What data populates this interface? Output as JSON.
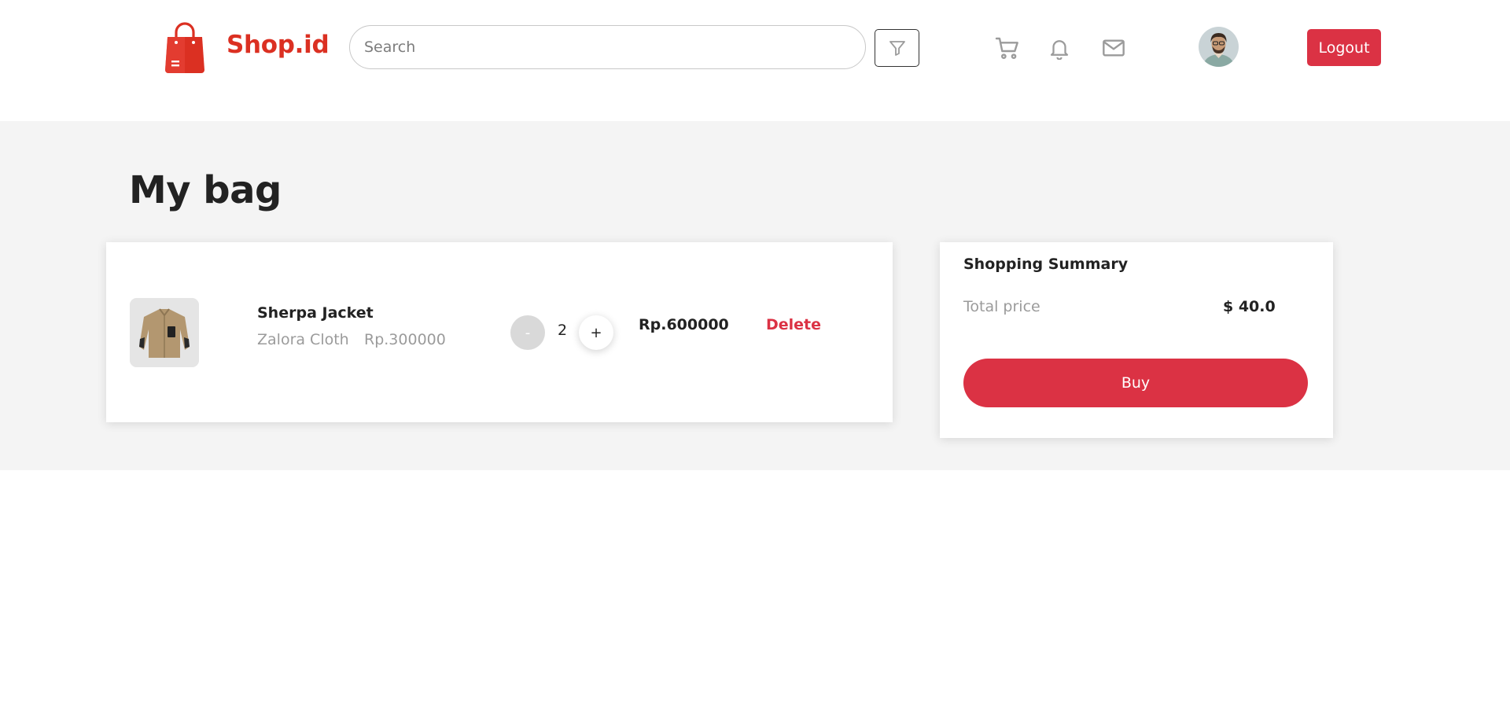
{
  "header": {
    "brand": "Shop.id",
    "search_placeholder": "Search",
    "search_value": "",
    "icons": [
      "bag-logo-icon",
      "filter-icon",
      "cart-icon",
      "bell-icon",
      "mail-icon"
    ],
    "logout_label": "Logout"
  },
  "page": {
    "title": "My bag"
  },
  "bag": {
    "items": [
      {
        "name": "Sherpa Jacket",
        "store": "Zalora Cloth",
        "unit_price": "Rp.300000",
        "quantity": "2",
        "minus_label": "-",
        "plus_label": "+",
        "line_total": "Rp.600000",
        "delete_label": "Delete"
      }
    ]
  },
  "summary": {
    "title": "Shopping Summary",
    "total_label": "Total price",
    "total_value": "$ 40.0",
    "buy_label": "Buy"
  },
  "colors": {
    "brand": "#DB3022",
    "accent": "#DB3244",
    "background": "#F4F4F4",
    "muted_text": "#9B9B9B"
  }
}
